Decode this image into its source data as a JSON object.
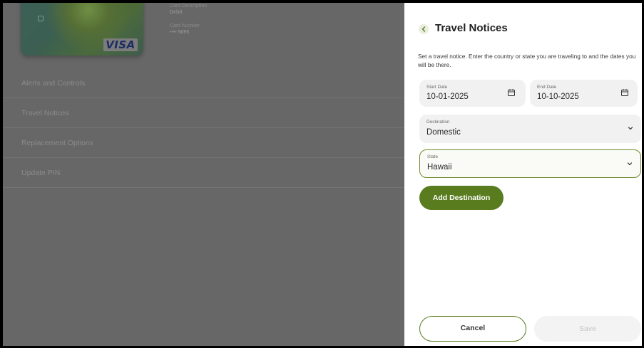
{
  "card": {
    "description_label": "Card Description",
    "description_value": "Debit",
    "number_label": "Card Number",
    "number_value": "•••• 5095",
    "brand": "VISA"
  },
  "menu": {
    "items": [
      {
        "label": "Alerts and Controls"
      },
      {
        "label": "Travel Notices"
      },
      {
        "label": "Replacement Options"
      },
      {
        "label": "Update PIN"
      }
    ]
  },
  "panel": {
    "title": "Travel Notices",
    "description": "Set a travel notice. Enter the country or state you are traveling to and the dates you will be there.",
    "start_date": {
      "label": "Start Date",
      "value": "10-01-2025"
    },
    "end_date": {
      "label": "End Date",
      "value": "10-10-2025"
    },
    "destination": {
      "label": "Destination",
      "value": "Domestic"
    },
    "state": {
      "label": "State",
      "value": "Hawaii"
    },
    "add_destination_label": "Add Destination",
    "cancel_label": "Cancel",
    "save_label": "Save"
  },
  "colors": {
    "accent": "#587c1e",
    "overlay": "#676767",
    "panel_bg": "#ffffff",
    "field_bg": "#f1f1f1"
  },
  "icons": {
    "back": "chevron-left-icon",
    "calendar": "calendar-icon",
    "dropdown": "chevron-down-icon"
  }
}
